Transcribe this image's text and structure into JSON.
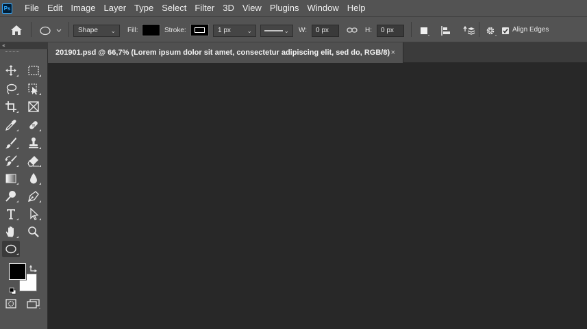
{
  "app": {
    "logo_text": "Ps",
    "menu": [
      "File",
      "Edit",
      "Image",
      "Layer",
      "Type",
      "Select",
      "Filter",
      "3D",
      "View",
      "Plugins",
      "Window",
      "Help"
    ]
  },
  "options_bar": {
    "home_icon": "home-icon",
    "tool_preset_icon": "ellipse-tool-icon",
    "mode_select": "Shape",
    "fill_label": "Fill:",
    "fill_color": "#000000",
    "stroke_label": "Stroke:",
    "stroke_width": "1 px",
    "stroke_style": "solid-line",
    "width_label": "W:",
    "width_value": "0 px",
    "link_icon": "link-icon",
    "height_label": "H:",
    "height_value": "0 px",
    "path_ops_icon": "path-operations-icon",
    "path_align_icon": "path-alignment-icon",
    "path_arrange_icon": "path-arrangement-icon",
    "settings_icon": "gear-icon",
    "align_edges_checked": true,
    "align_edges_label": "Align Edges"
  },
  "panel_collapse": "«",
  "document": {
    "tab_title": "201901.psd @ 66,7% (Lorem ipsum dolor sit amet, consectetur adipiscing elit, sed do, RGB/8)",
    "close_glyph": "×"
  },
  "toolbar": {
    "tools": [
      "move-tool-icon",
      "rectangular-marquee-icon",
      "lasso-icon",
      "object-selection-icon",
      "crop-icon",
      "frame-icon",
      "eyedropper-icon",
      "healing-brush-icon",
      "brush-icon",
      "clone-stamp-icon",
      "history-brush-icon",
      "eraser-icon",
      "gradient-icon",
      "blur-icon",
      "dodge-icon",
      "pen-icon",
      "type-icon",
      "path-selection-icon",
      "hand-icon",
      "zoom-icon",
      "ellipse-tool-icon"
    ],
    "active_tool": "ellipse-tool-icon",
    "foreground_color": "#000000",
    "background_color": "#ffffff"
  }
}
